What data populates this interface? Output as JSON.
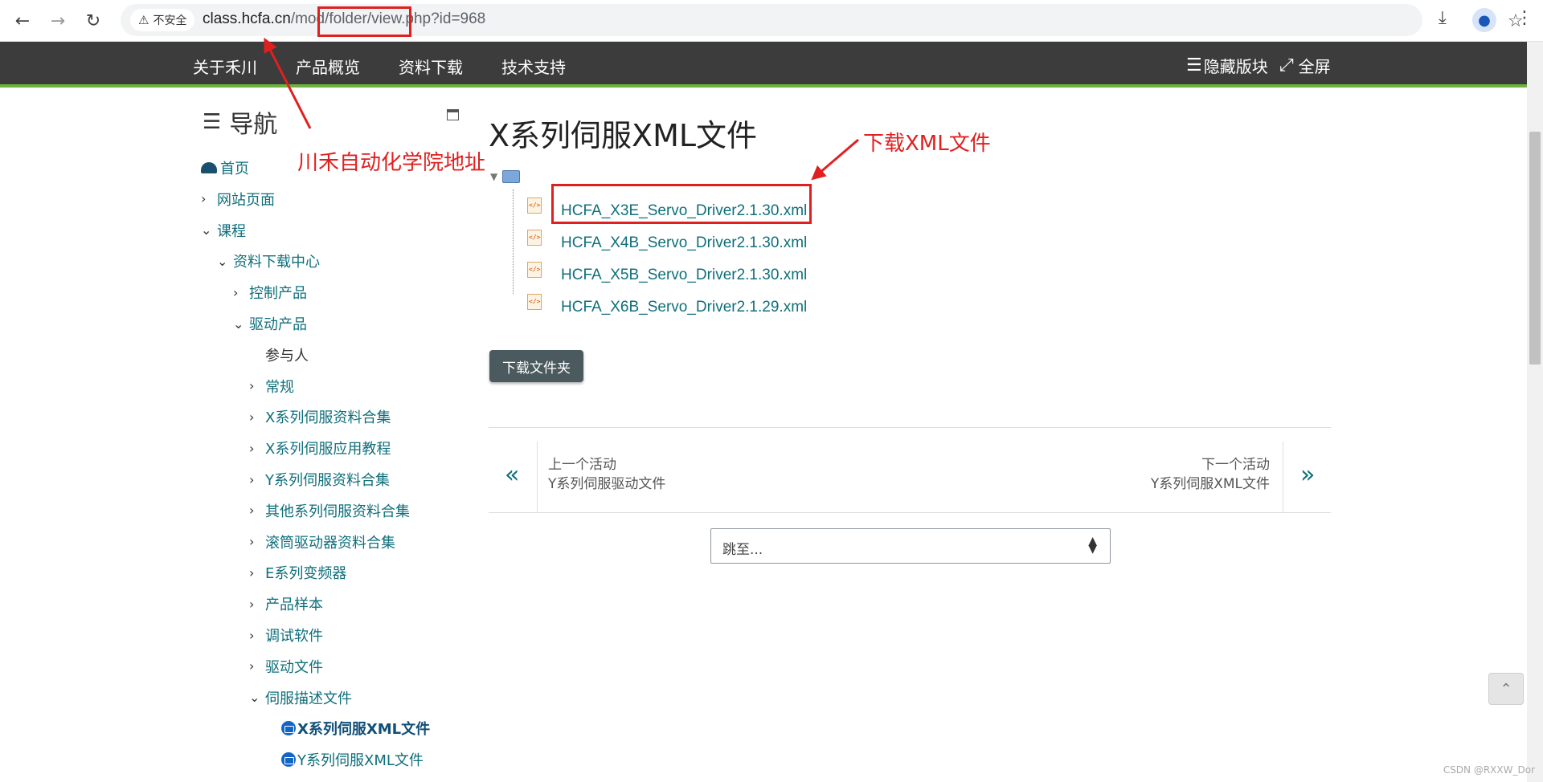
{
  "browser": {
    "back_icon": "←",
    "forward_icon": "→",
    "reload_icon": "↻",
    "secure_label": "不安全",
    "url_host": "class.hcfa.cn",
    "url_path": "/mod/folder/view.php?id=968",
    "star_icon": "☆",
    "download_icon": "⤓",
    "menu_icon": "⋮"
  },
  "site_nav": {
    "items": [
      "关于禾川",
      "产品概览",
      "资料下载",
      "技术支持"
    ],
    "hide_blocks": "隐藏版块",
    "fullscreen": "全屏"
  },
  "nav_block": {
    "title": "导航",
    "items": [
      {
        "label": "首页",
        "level": 0,
        "chev": ""
      },
      {
        "label": "网站页面",
        "level": 0,
        "chev": "›"
      },
      {
        "label": "课程",
        "level": 0,
        "chev": "⌄"
      },
      {
        "label": "资料下载中心",
        "level": 1,
        "chev": "⌄"
      },
      {
        "label": "控制产品",
        "level": 2,
        "chev": "›"
      },
      {
        "label": "驱动产品",
        "level": 2,
        "chev": "⌄"
      },
      {
        "label": "参与人",
        "level": 3,
        "chev": ""
      },
      {
        "label": "常规",
        "level": 3,
        "chev": "›"
      },
      {
        "label": "X系列伺服资料合集",
        "level": 3,
        "chev": "›"
      },
      {
        "label": "X系列伺服应用教程",
        "level": 3,
        "chev": "›"
      },
      {
        "label": "Y系列伺服资料合集",
        "level": 3,
        "chev": "›"
      },
      {
        "label": "其他系列伺服资料合集",
        "level": 3,
        "chev": "›"
      },
      {
        "label": "滚筒驱动器资料合集",
        "level": 3,
        "chev": "›"
      },
      {
        "label": "E系列变频器",
        "level": 3,
        "chev": "›"
      },
      {
        "label": "产品样本",
        "level": 3,
        "chev": "›"
      },
      {
        "label": "调试软件",
        "level": 3,
        "chev": "›"
      },
      {
        "label": "驱动文件",
        "level": 3,
        "chev": "›"
      },
      {
        "label": "伺服描述文件",
        "level": 3,
        "chev": "⌄"
      },
      {
        "label": "X系列伺服XML文件",
        "level": 4,
        "chev": ""
      },
      {
        "label": "Y系列伺服XML文件",
        "level": 4,
        "chev": ""
      }
    ]
  },
  "main": {
    "title": "X系列伺服XML文件",
    "files": [
      "HCFA_X3E_Servo_Driver2.1.30.xml",
      "HCFA_X4B_Servo_Driver2.1.30.xml",
      "HCFA_X5B_Servo_Driver2.1.30.xml",
      "HCFA_X6B_Servo_Driver2.1.29.xml"
    ],
    "download_folder": "下载文件夹",
    "prev_label": "上一个活动",
    "prev_name": "Y系列伺服驱动文件",
    "next_label": "下一个活动",
    "next_name": "Y系列伺服XML文件",
    "jump_placeholder": "跳至..."
  },
  "annotations": {
    "address_note": "川禾自动化学院地址",
    "download_note": "下载XML文件",
    "color": "#e02020"
  },
  "watermark": "CSDN @RXXW_Dor"
}
